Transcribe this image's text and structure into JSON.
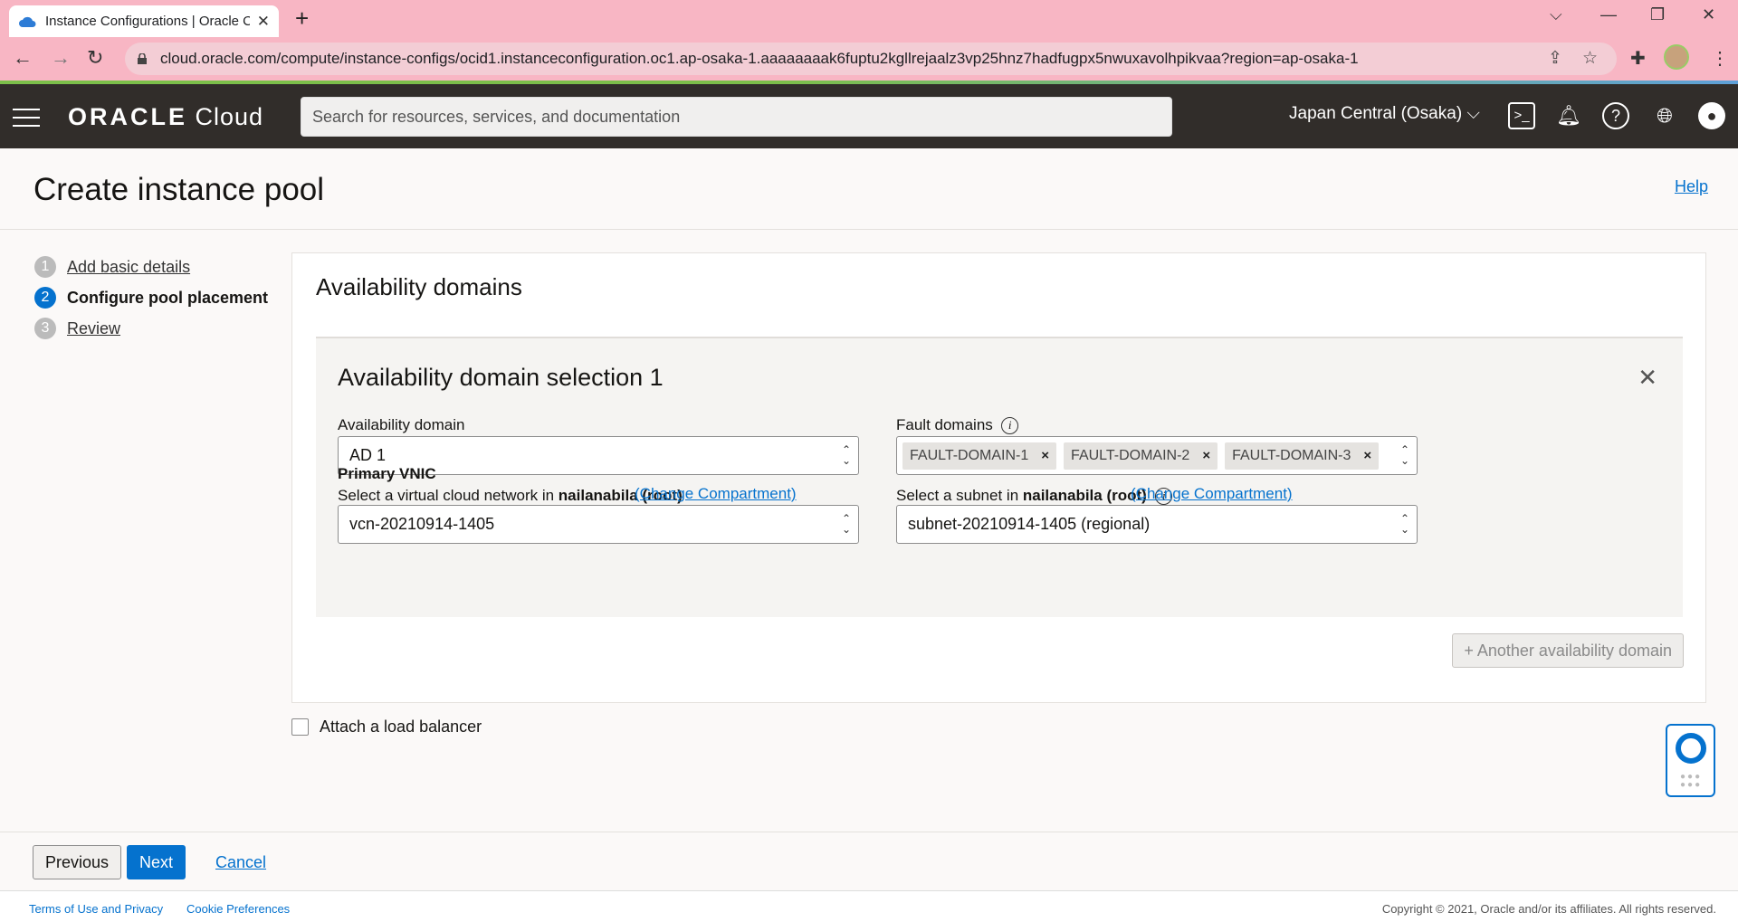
{
  "browser": {
    "tab_title": "Instance Configurations | Oracle C",
    "url": "cloud.oracle.com/compute/instance-configs/ocid1.instanceconfiguration.oc1.ap-osaka-1.aaaaaaaak6fuptu2kgllrejaalz3vp25hnz7hadfugpx5nwuxavolhpikvaa?region=ap-osaka-1"
  },
  "header": {
    "logo_main": "ORACLE",
    "logo_sub": " Cloud",
    "search_placeholder": "Search for resources, services, and documentation",
    "region": "Japan Central (Osaka)"
  },
  "page": {
    "title": "Create instance pool",
    "help": "Help"
  },
  "steps": [
    {
      "num": "1",
      "label": "Add basic details"
    },
    {
      "num": "2",
      "label": "Configure pool placement"
    },
    {
      "num": "3",
      "label": "Review"
    }
  ],
  "card": {
    "title": "Availability domains",
    "selection_title": "Availability domain selection 1",
    "ad_label": "Availability domain",
    "ad_value": "AD 1",
    "fd_label": "Fault domains",
    "fault_domains": [
      "FAULT-DOMAIN-1",
      "FAULT-DOMAIN-2",
      "FAULT-DOMAIN-3"
    ],
    "primary_vnic": "Primary VNIC",
    "vcn_label_prefix": "Select a virtual cloud network in ",
    "vcn_label_comp": "nailanabila (root)",
    "change_comp": "(Change Compartment)",
    "vcn_value": "vcn-20210914-1405",
    "subnet_label_prefix": "Select a subnet in ",
    "subnet_label_comp": "nailanabila (root)",
    "subnet_value": "subnet-20210914-1405 (regional)",
    "another": "+ Another availability domain"
  },
  "load_balancer": "Attach a load balancer",
  "footer": {
    "previous": "Previous",
    "next": "Next",
    "cancel": "Cancel"
  },
  "bottom": {
    "terms": "Terms of Use and Privacy",
    "cookie": "Cookie Preferences",
    "copyright": "Copyright © 2021, Oracle and/or its affiliates. All rights reserved."
  }
}
